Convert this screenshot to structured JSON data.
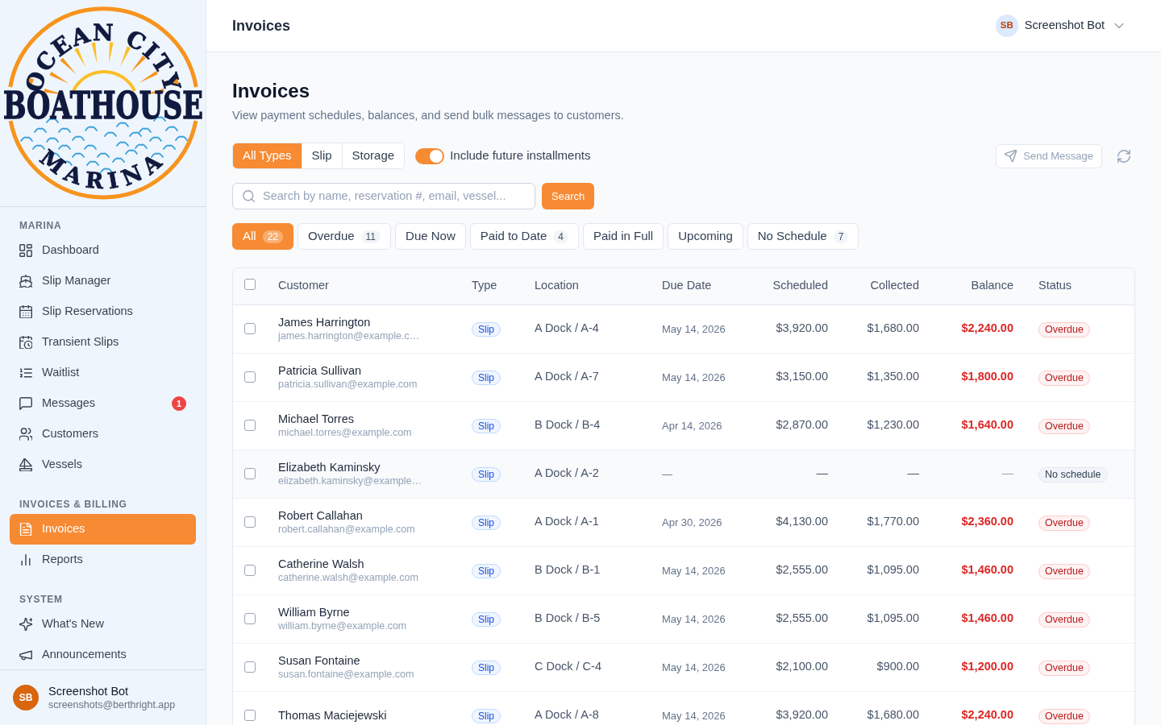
{
  "sidebar": {
    "logo": {
      "top_text": "OCEAN CITY",
      "main_text": "BOATHOUSE",
      "bottom_text": "MARINA"
    },
    "sections": [
      {
        "title": "MARINA",
        "items": [
          {
            "label": "Dashboard",
            "selected": false
          },
          {
            "label": "Slip Manager",
            "selected": false
          },
          {
            "label": "Slip Reservations",
            "selected": false
          },
          {
            "label": "Transient Slips",
            "selected": false
          },
          {
            "label": "Waitlist",
            "selected": false
          },
          {
            "label": "Messages",
            "selected": false,
            "badge": "1"
          },
          {
            "label": "Customers",
            "selected": false
          },
          {
            "label": "Vessels",
            "selected": false
          }
        ]
      },
      {
        "title": "INVOICES & BILLING",
        "items": [
          {
            "label": "Invoices",
            "selected": true
          },
          {
            "label": "Reports",
            "selected": false
          }
        ]
      },
      {
        "title": "SYSTEM",
        "items": [
          {
            "label": "What's New",
            "selected": false
          },
          {
            "label": "Announcements",
            "selected": false
          }
        ]
      }
    ],
    "user": {
      "initials": "SB",
      "name": "Screenshot Bot",
      "email": "screenshots@berthright.app"
    }
  },
  "header": {
    "title": "Invoices",
    "user": {
      "initials": "SB",
      "name": "Screenshot Bot"
    }
  },
  "page": {
    "title": "Invoices",
    "subtitle": "View payment schedules, balances, and send bulk messages to customers."
  },
  "toolbar": {
    "type_filters": [
      {
        "label": "All Types",
        "selected": true
      },
      {
        "label": "Slip",
        "selected": false
      },
      {
        "label": "Storage",
        "selected": false
      }
    ],
    "toggle": {
      "label": "Include future installments",
      "on": true
    },
    "send_button": {
      "label": "Send Message",
      "disabled": true
    }
  },
  "search": {
    "placeholder": "Search by name, reservation #, email, vessel...",
    "button": "Search"
  },
  "status_filters": [
    {
      "label": "All",
      "count": "22",
      "selected": true
    },
    {
      "label": "Overdue",
      "count": "11",
      "selected": false
    },
    {
      "label": "Due Now",
      "selected": false
    },
    {
      "label": "Paid to Date",
      "count": "4",
      "selected": false
    },
    {
      "label": "Paid in Full",
      "selected": false
    },
    {
      "label": "Upcoming",
      "selected": false
    },
    {
      "label": "No Schedule",
      "count": "7",
      "selected": false
    }
  ],
  "table": {
    "select_all": {
      "checked": false
    },
    "columns": [
      "Customer",
      "Type",
      "Location",
      "Due Date",
      "Scheduled",
      "Collected",
      "Balance",
      "Status"
    ],
    "rows": [
      {
        "checked": false,
        "name": "James Harrington",
        "email": "james.harrington@example.c…",
        "type": "Slip",
        "location": "A Dock / A-4",
        "due_date": "May 14, 2026",
        "scheduled": "$3,920.00",
        "collected": "$1,680.00",
        "balance": "$2,240.00",
        "status": {
          "label": "Overdue",
          "kind": "overdue"
        }
      },
      {
        "checked": false,
        "name": "Patricia Sullivan",
        "email": "patricia.sullivan@example.com",
        "type": "Slip",
        "location": "A Dock / A-7",
        "due_date": "May 14, 2026",
        "scheduled": "$3,150.00",
        "collected": "$1,350.00",
        "balance": "$1,800.00",
        "status": {
          "label": "Overdue",
          "kind": "overdue"
        }
      },
      {
        "checked": false,
        "name": "Michael Torres",
        "email": "michael.torres@example.com",
        "type": "Slip",
        "location": "B Dock / B-4",
        "due_date": "Apr 14, 2026",
        "scheduled": "$2,870.00",
        "collected": "$1,230.00",
        "balance": "$1,640.00",
        "status": {
          "label": "Overdue",
          "kind": "overdue"
        }
      },
      {
        "checked": false,
        "name": "Elizabeth Kaminsky",
        "email": "elizabeth.kaminsky@example…",
        "type": "Slip",
        "location": "A Dock / A-2",
        "due_date": "—",
        "scheduled": "—",
        "collected": "—",
        "balance": "—",
        "status": {
          "label": "No schedule",
          "kind": "no_schedule"
        }
      },
      {
        "checked": false,
        "name": "Robert Callahan",
        "email": "robert.callahan@example.com",
        "type": "Slip",
        "location": "A Dock / A-1",
        "due_date": "Apr 30, 2026",
        "scheduled": "$4,130.00",
        "collected": "$1,770.00",
        "balance": "$2,360.00",
        "status": {
          "label": "Overdue",
          "kind": "overdue"
        }
      },
      {
        "checked": false,
        "name": "Catherine Walsh",
        "email": "catherine.walsh@example.com",
        "type": "Slip",
        "location": "B Dock / B-1",
        "due_date": "May 14, 2026",
        "scheduled": "$2,555.00",
        "collected": "$1,095.00",
        "balance": "$1,460.00",
        "status": {
          "label": "Overdue",
          "kind": "overdue"
        }
      },
      {
        "checked": false,
        "name": "William Byrne",
        "email": "william.byrne@example.com",
        "type": "Slip",
        "location": "B Dock / B-5",
        "due_date": "May 14, 2026",
        "scheduled": "$2,555.00",
        "collected": "$1,095.00",
        "balance": "$1,460.00",
        "status": {
          "label": "Overdue",
          "kind": "overdue"
        }
      },
      {
        "checked": false,
        "name": "Susan Fontaine",
        "email": "susan.fontaine@example.com",
        "type": "Slip",
        "location": "C Dock / C-4",
        "due_date": "May 14, 2026",
        "scheduled": "$2,100.00",
        "collected": "$900.00",
        "balance": "$1,200.00",
        "status": {
          "label": "Overdue",
          "kind": "overdue"
        }
      },
      {
        "checked": false,
        "name": "Thomas Maciejewski",
        "type": "Slip",
        "location": "A Dock / A-8",
        "due_date": "May 14, 2026",
        "scheduled": "$3,920.00",
        "collected": "$1,680.00",
        "balance": "$2,240.00",
        "status": {
          "label": "Overdue",
          "kind": "overdue"
        }
      }
    ]
  }
}
